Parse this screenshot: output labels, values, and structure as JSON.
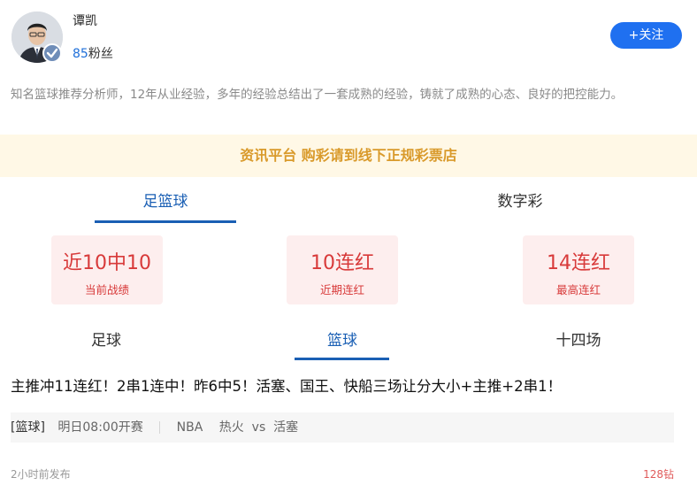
{
  "author": {
    "name": "谭凯",
    "fans_count": "85",
    "fans_label": "粉丝",
    "follow_label": "+关注",
    "bio": "知名篮球推荐分析师，12年从业经验，多年的经验总结出了一套成熟的经验，铸就了成熟的心态、良好的把控能力。"
  },
  "notice": "资讯平台 购彩请到线下正规彩票店",
  "main_tabs": [
    {
      "label": "足篮球",
      "active": true
    },
    {
      "label": "数字彩",
      "active": false
    }
  ],
  "stats": [
    {
      "value": "近10中10",
      "label": "当前战绩"
    },
    {
      "value": "10连红",
      "label": "近期连红"
    },
    {
      "value": "14连红",
      "label": "最高连红"
    }
  ],
  "sub_tabs": [
    {
      "label": "足球",
      "active": false
    },
    {
      "label": "篮球",
      "active": true
    },
    {
      "label": "十四场",
      "active": false
    }
  ],
  "article": {
    "headline": "主推冲11连红！2串1连中！昨6中5！活塞、国王、快船三场让分大小+主推+2串1！",
    "match": {
      "tag": "[篮球]",
      "start": "明日08:00开赛",
      "league": "NBA",
      "teams": "热火  vs  活塞"
    },
    "posted": "2小时前发布",
    "price": "128钻"
  },
  "colors": {
    "accent_blue": "#1a5fb4",
    "follow_button": "#1f70f0",
    "stat_red": "#d83a3a",
    "notice_gold": "#d99a2b"
  }
}
